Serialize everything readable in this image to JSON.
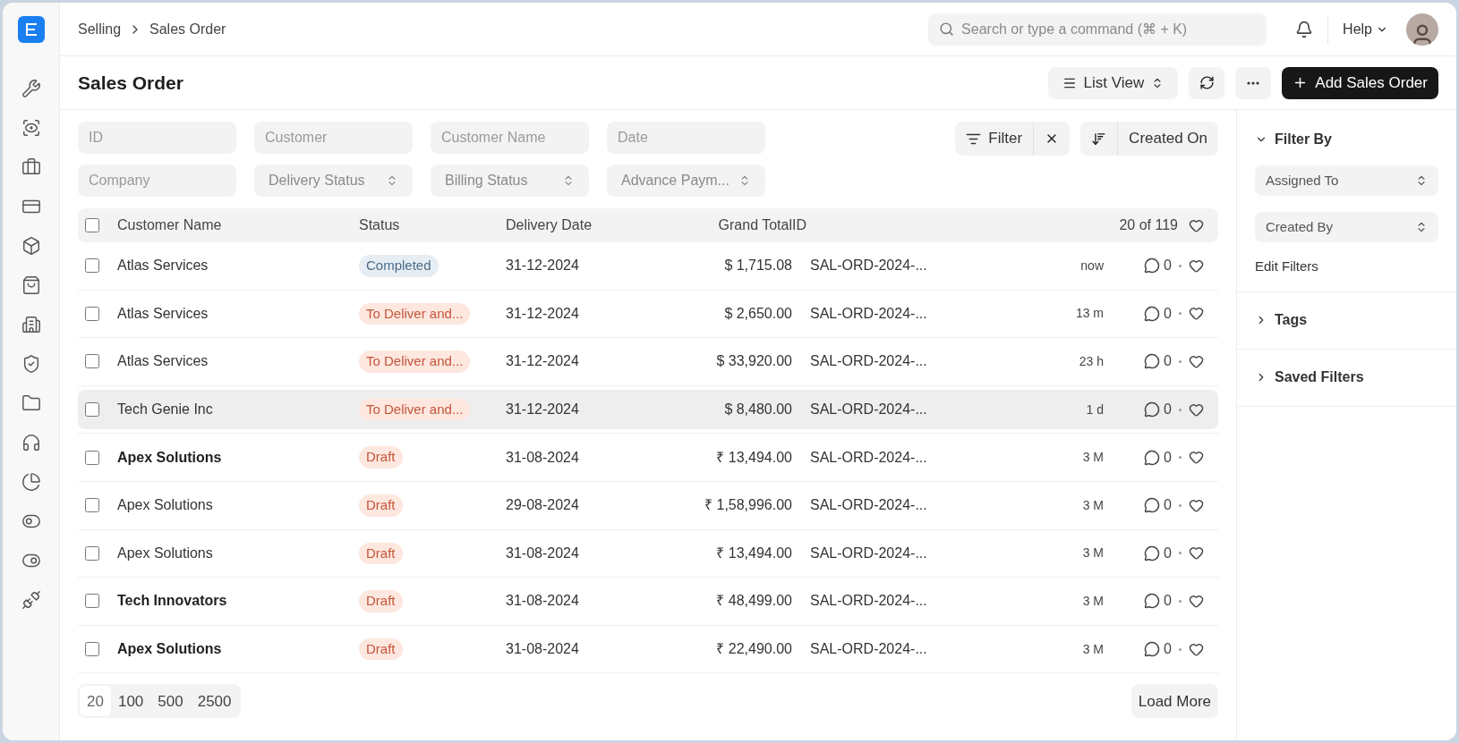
{
  "breadcrumbs": [
    "Selling",
    "Sales Order"
  ],
  "search": {
    "placeholder": "Search or type a command (⌘ + K)"
  },
  "help": "Help",
  "page_title": "Sales Order",
  "toolbar": {
    "view": "List View",
    "add": "Add Sales Order"
  },
  "filter_fields": [
    {
      "kind": "text",
      "placeholder": "ID"
    },
    {
      "kind": "text",
      "placeholder": "Customer"
    },
    {
      "kind": "text",
      "placeholder": "Customer Name"
    },
    {
      "kind": "text",
      "placeholder": "Date"
    },
    {
      "kind": "text",
      "placeholder": "Company"
    },
    {
      "kind": "select",
      "placeholder": "Delivery Status"
    },
    {
      "kind": "select",
      "placeholder": "Billing Status"
    },
    {
      "kind": "select",
      "placeholder": "Advance Paym..."
    }
  ],
  "filter_button": "Filter",
  "sort_button": "Created On",
  "table": {
    "columns": [
      "Customer Name",
      "Status",
      "Delivery Date",
      "Grand Total",
      "ID"
    ],
    "count": "20 of 119",
    "all_checked": false,
    "rows": [
      {
        "customer": "Atlas Services",
        "unread": false,
        "highlighted": false,
        "checked": false,
        "status": "Completed",
        "kind": "completed",
        "date": "31-12-2024",
        "total": "$ 1,715.08",
        "id": "SAL-ORD-2024-...",
        "time": "now",
        "comments": "0"
      },
      {
        "customer": "Atlas Services",
        "unread": false,
        "highlighted": false,
        "checked": false,
        "status": "To Deliver and...",
        "kind": "pending",
        "date": "31-12-2024",
        "total": "$ 2,650.00",
        "id": "SAL-ORD-2024-...",
        "time": "13 m",
        "comments": "0"
      },
      {
        "customer": "Atlas Services",
        "unread": false,
        "highlighted": false,
        "checked": false,
        "status": "To Deliver and...",
        "kind": "pending",
        "date": "31-12-2024",
        "total": "$ 33,920.00",
        "id": "SAL-ORD-2024-...",
        "time": "23 h",
        "comments": "0"
      },
      {
        "customer": "Tech Genie Inc",
        "unread": false,
        "highlighted": true,
        "checked": false,
        "status": "To Deliver and...",
        "kind": "pending",
        "date": "31-12-2024",
        "total": "$ 8,480.00",
        "id": "SAL-ORD-2024-...",
        "time": "1 d",
        "comments": "0"
      },
      {
        "customer": "Apex Solutions",
        "unread": true,
        "highlighted": false,
        "checked": false,
        "status": "Draft",
        "kind": "draft",
        "date": "31-08-2024",
        "total": "₹ 13,494.00",
        "id": "SAL-ORD-2024-...",
        "time": "3 M",
        "comments": "0"
      },
      {
        "customer": "Apex Solutions",
        "unread": false,
        "highlighted": false,
        "checked": false,
        "status": "Draft",
        "kind": "draft",
        "date": "29-08-2024",
        "total": "₹ 1,58,996.00",
        "id": "SAL-ORD-2024-...",
        "time": "3 M",
        "comments": "0"
      },
      {
        "customer": "Apex Solutions",
        "unread": false,
        "highlighted": false,
        "checked": false,
        "status": "Draft",
        "kind": "draft",
        "date": "31-08-2024",
        "total": "₹ 13,494.00",
        "id": "SAL-ORD-2024-...",
        "time": "3 M",
        "comments": "0"
      },
      {
        "customer": "Tech Innovators",
        "unread": true,
        "highlighted": false,
        "checked": false,
        "status": "Draft",
        "kind": "draft",
        "date": "31-08-2024",
        "total": "₹ 48,499.00",
        "id": "SAL-ORD-2024-...",
        "time": "3 M",
        "comments": "0"
      },
      {
        "customer": "Apex Solutions",
        "unread": true,
        "highlighted": false,
        "checked": false,
        "status": "Draft",
        "kind": "draft",
        "date": "31-08-2024",
        "total": "₹ 22,490.00",
        "id": "SAL-ORD-2024-...",
        "time": "3 M",
        "comments": "0"
      }
    ]
  },
  "page_sizes": [
    {
      "label": "20",
      "selected": true
    },
    {
      "label": "100",
      "selected": false
    },
    {
      "label": "500",
      "selected": false
    },
    {
      "label": "2500",
      "selected": false
    }
  ],
  "load_more": "Load More",
  "sidebar": {
    "filter_by": {
      "title": "Filter By",
      "expanded": true,
      "selects": [
        "Assigned To",
        "Created By"
      ],
      "edit": "Edit Filters"
    },
    "sections": [
      {
        "title": "Tags",
        "expanded": false
      },
      {
        "title": "Saved Filters",
        "expanded": false
      }
    ]
  }
}
